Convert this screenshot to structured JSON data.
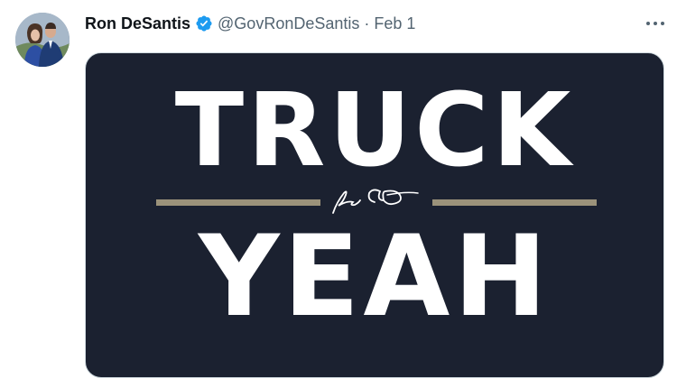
{
  "tweet": {
    "author_name": "Ron DeSantis",
    "handle": "@GovRonDeSantis",
    "separator": "·",
    "date": "Feb 1",
    "avatar_icon": "profile-photo",
    "verified_icon": "verified-badge-icon",
    "more_icon": "more-options-icon"
  },
  "media": {
    "line1": "TRUCK",
    "line2": "YEAH",
    "signature": "RD",
    "colors": {
      "background": "#1b2130",
      "text": "#ffffff",
      "rule": "#9b927a"
    }
  },
  "colors": {
    "name": "#0f1419",
    "meta": "#536471",
    "verified": "#1d9bf0"
  }
}
